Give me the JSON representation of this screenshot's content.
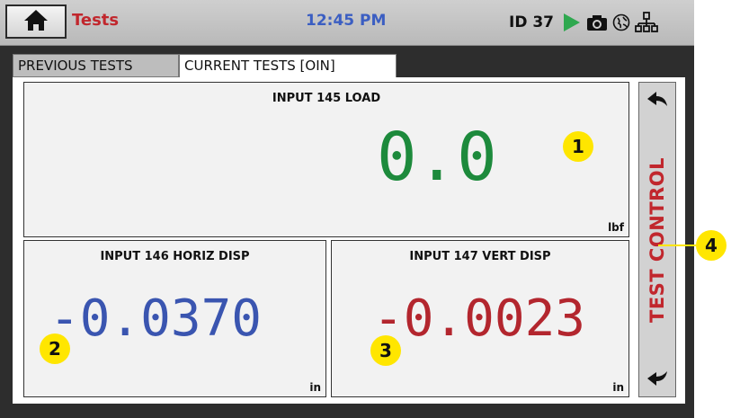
{
  "header": {
    "title": "Tests",
    "time": "12:45 PM",
    "id_label": "ID 37"
  },
  "tabs": [
    {
      "label": "PREVIOUS TESTS",
      "active": false
    },
    {
      "label": "CURRENT TESTS [OIN]",
      "active": true
    }
  ],
  "cards": {
    "load": {
      "label": "INPUT 145 LOAD",
      "value": "0.0",
      "unit": "lbf"
    },
    "horiz": {
      "label": "INPUT 146 HORIZ DISP",
      "value": "-0.0370",
      "unit": "in"
    },
    "vert": {
      "label": "INPUT 147 VERT DISP",
      "value": "-0.0023",
      "unit": "in"
    }
  },
  "side_control": {
    "label": "TEST CONTROL"
  },
  "callouts": [
    "1",
    "2",
    "3",
    "4"
  ],
  "icons": {
    "home": "home-icon",
    "play": "play-icon",
    "camera": "camera-icon",
    "globe": "globe-icon",
    "network": "network-icon",
    "arrow_up": "arrow-back-up-icon",
    "arrow_down": "arrow-back-down-icon"
  },
  "colors": {
    "title": "#c1272d",
    "time": "#3b5ec2",
    "load_value": "#1d8a3c",
    "horiz_value": "#3a55b0",
    "vert_value": "#b3262e",
    "play": "#2fa84f",
    "callout": "#ffe600"
  }
}
